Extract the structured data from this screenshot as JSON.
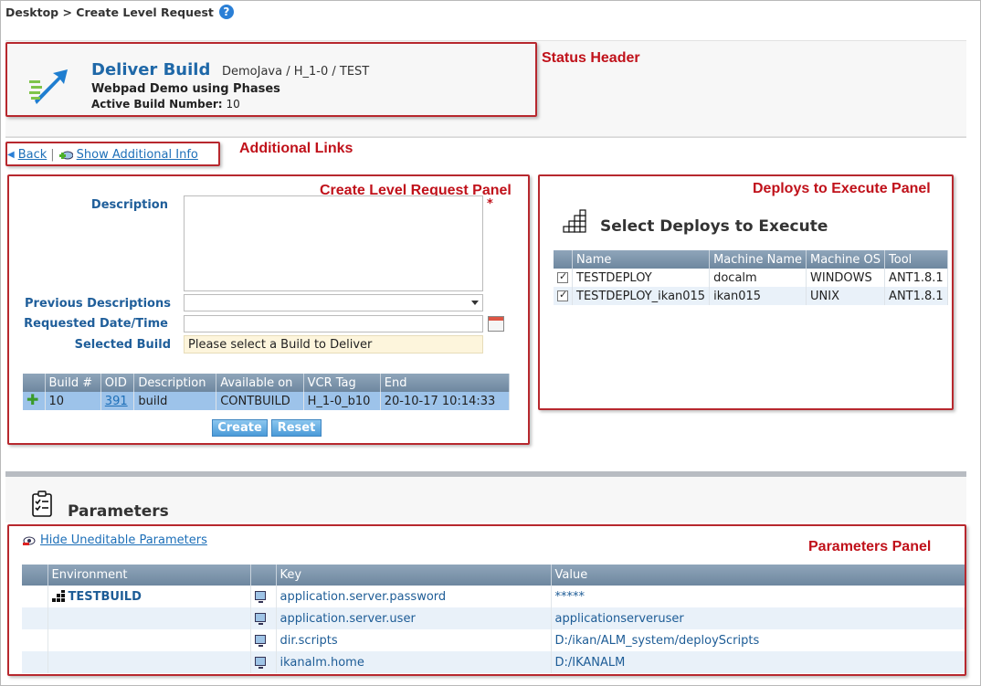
{
  "breadcrumb": {
    "text": "Desktop > Create Level Request",
    "help_icon": "?"
  },
  "header": {
    "title": "Deliver Build",
    "path": "DemoJava / H_1-0 / TEST",
    "subtitle": "Webpad Demo using Phases",
    "active_build_label": "Active Build Number:",
    "active_build_value": "10"
  },
  "callouts": {
    "status_header": "Status Header",
    "additional_links": "Additional Links",
    "create_panel": "Create Level Request Panel",
    "deploys_panel": "Deploys to Execute Panel",
    "parameters_panel": "Parameters Panel"
  },
  "links": {
    "back": "Back",
    "show_info": "Show Additional Info",
    "separator": "|"
  },
  "form": {
    "description_label": "Description",
    "description_value": "",
    "required_mark": "*",
    "previous_label": "Previous Descriptions",
    "previous_value": "",
    "requested_label": "Requested Date/Time",
    "requested_value": "",
    "selected_build_label": "Selected Build",
    "selected_build_value": "Please select a Build to Deliver"
  },
  "builds": {
    "headers": [
      "",
      "Build #",
      "OID",
      "Description",
      "Available on",
      "VCR Tag",
      "End"
    ],
    "rows": [
      {
        "build": "10",
        "oid": "391",
        "description": "build",
        "available_on": "CONTBUILD",
        "vcr_tag": "H_1-0_b10",
        "end": "20-10-17 10:14:33"
      }
    ]
  },
  "buttons": {
    "create": "Create",
    "reset": "Reset"
  },
  "deploys": {
    "title": "Select Deploys to Execute",
    "headers": [
      "",
      "Name",
      "Machine Name",
      "Machine OS",
      "Tool"
    ],
    "rows": [
      {
        "checked": true,
        "name": "TESTDEPLOY",
        "machine": "docalm",
        "os": "WINDOWS",
        "tool": "ANT1.8.1"
      },
      {
        "checked": true,
        "name": "TESTDEPLOY_ikan015",
        "machine": "ikan015",
        "os": "UNIX",
        "tool": "ANT1.8.1"
      }
    ]
  },
  "parameters": {
    "title": "Parameters",
    "hide_link": "Hide Uneditable Parameters",
    "headers": [
      "",
      "Environment",
      "",
      "Key",
      "Value"
    ],
    "rows": [
      {
        "env": "TESTBUILD",
        "key": "application.server.password",
        "value": "*****"
      },
      {
        "env": "",
        "key": "application.server.user",
        "value": "applicationserveruser"
      },
      {
        "env": "",
        "key": "dir.scripts",
        "value": "D:/ikan/ALM_system/deployScripts"
      },
      {
        "env": "",
        "key": "ikanalm.home",
        "value": "D:/IKANALM"
      }
    ]
  },
  "colors": {
    "accent": "#1f68a8",
    "callout": "#c0111a",
    "selected_row": "#9dc3ea"
  }
}
